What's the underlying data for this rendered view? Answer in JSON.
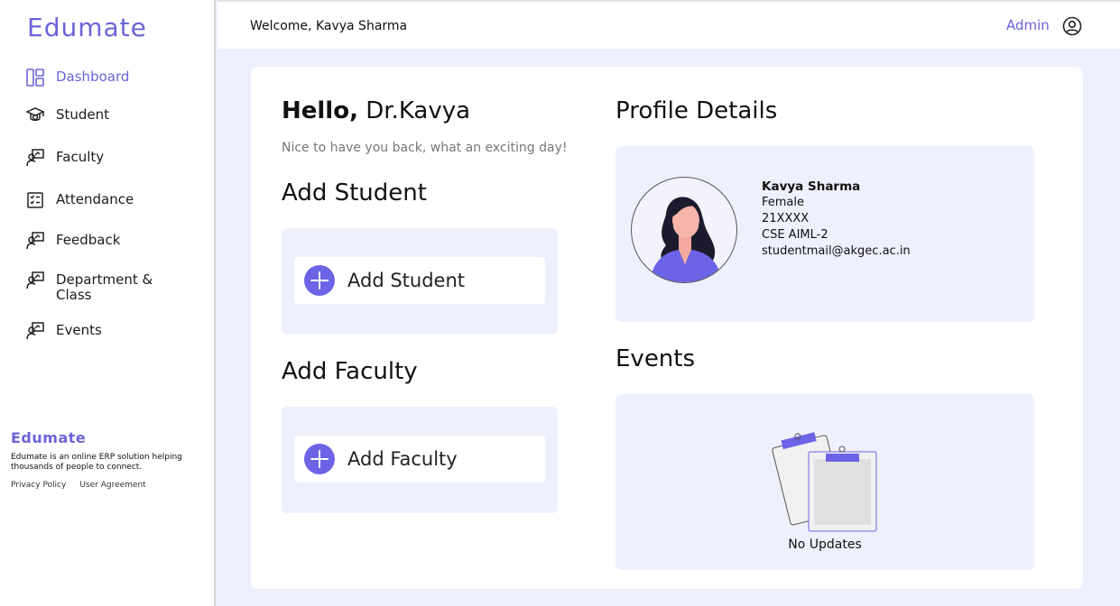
{
  "sidebar": {
    "brand": "Edumate",
    "items": [
      {
        "label": "Dashboard",
        "icon": "dashboard-icon",
        "active": true
      },
      {
        "label": "Student",
        "icon": "graduation-cap-icon"
      },
      {
        "label": "Faculty",
        "icon": "teacher-board-icon"
      },
      {
        "label": "Attendance",
        "icon": "checklist-icon"
      },
      {
        "label": "Feedback",
        "icon": "teacher-board-icon"
      },
      {
        "label": "Department & Class",
        "icon": "teacher-board-icon"
      },
      {
        "label": "Events",
        "icon": "teacher-board-icon"
      }
    ],
    "footer": {
      "brand": "Edumate",
      "description": "Edumate is an online ERP solution helping thousands of people to connect.",
      "links": [
        "Privacy Policy",
        "User Agreement"
      ]
    }
  },
  "header": {
    "welcome": "Welcome, Kavya Sharma",
    "role": "Admin",
    "user_icon": "user-circle-icon"
  },
  "main": {
    "greeting_bold": "Hello,",
    "greeting_name": "Dr.Kavya",
    "subtitle": "Nice to have you back, what an exciting day!",
    "add_student_title": "Add Student",
    "add_student_button": "Add Student",
    "add_faculty_title": "Add Faculty",
    "add_faculty_button": "Add Faculty",
    "profile_title": "Profile Details",
    "profile": {
      "name": "Kavya Sharma",
      "gender": "Female",
      "id": "21XXXX",
      "branch": "CSE AIML-2",
      "email": "studentmail@akgec.ac.in"
    },
    "events_title": "Events",
    "events_empty": "No Updates"
  },
  "colors": {
    "accent": "#6c63d9",
    "panel": "#eef0fd",
    "background": "#eef0fd"
  }
}
